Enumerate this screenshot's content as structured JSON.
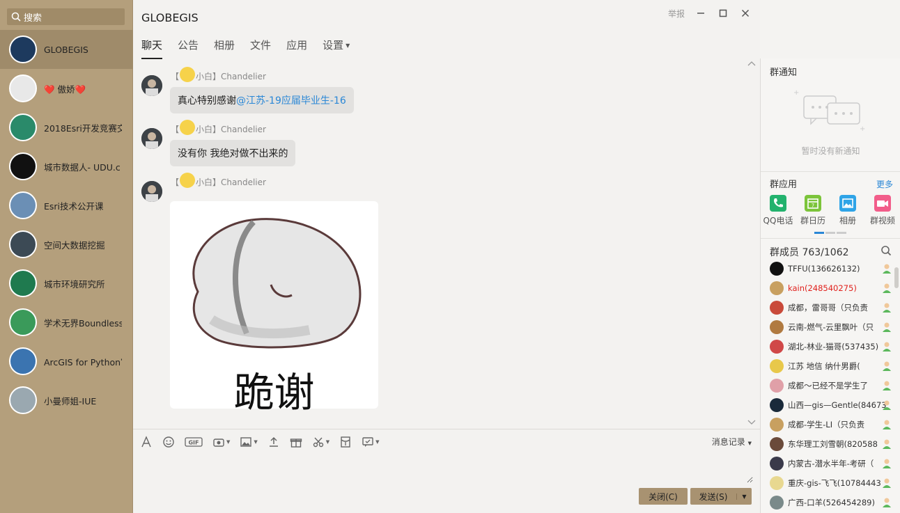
{
  "sidebar": {
    "search_label": "搜索",
    "conversations": [
      {
        "name": "GLOBEGIS",
        "avatar_color": "#1d3a5e"
      },
      {
        "name": "❤️ 傲娇❤️",
        "avatar_color": "#e8e8e8"
      },
      {
        "name": "2018Esri开发竞赛交",
        "avatar_color": "#2a8a6a"
      },
      {
        "name": "城市数据人- UDU.c",
        "avatar_color": "#111111"
      },
      {
        "name": "Esri技术公开课",
        "avatar_color": "#6b8fb5"
      },
      {
        "name": "空间大数据挖掘",
        "avatar_color": "#3c4a55"
      },
      {
        "name": "城市环境研究所",
        "avatar_color": "#1f7a4f"
      },
      {
        "name": "学术无界Boundless",
        "avatar_color": "#3a9a5a"
      },
      {
        "name": "ArcGIS for Python官",
        "avatar_color": "#3b74b0"
      },
      {
        "name": "小曼师姐-IUE",
        "avatar_color": "#9aa8b0"
      }
    ]
  },
  "header": {
    "title": "GLOBEGIS",
    "report_label": "举报",
    "tabs": [
      "聊天",
      "公告",
      "相册",
      "文件",
      "应用",
      "设置"
    ]
  },
  "messages": [
    {
      "sender_prefix": "【",
      "sender_tag": "小白",
      "sender_suffix": "】Chandelier",
      "text": "真心特别感谢",
      "mention": "@江苏-19应届毕业生-16"
    },
    {
      "sender_prefix": "【",
      "sender_tag": "小白",
      "sender_suffix": "】Chandelier",
      "text": "没有你  我绝对做不出来的"
    },
    {
      "sender_prefix": "【",
      "sender_tag": "小白",
      "sender_suffix": "】Chandelier",
      "sticker_caption": "跪谢"
    }
  ],
  "toolbar": {
    "history_label": "消息记录"
  },
  "input": {
    "value": ""
  },
  "actions": {
    "close_label": "关闭(C)",
    "send_label": "发送(S)"
  },
  "right_panel": {
    "notice_title": "群通知",
    "notice_empty": "暂时没有新通知",
    "apps_title": "群应用",
    "apps_more": "更多",
    "apps": [
      {
        "label": "QQ电话",
        "color": "#23b26d"
      },
      {
        "label": "群日历",
        "color": "#7cc43a"
      },
      {
        "label": "相册",
        "color": "#2fa4e7"
      },
      {
        "label": "群视频",
        "color": "#f25d8a"
      }
    ],
    "members_title": "群成员 763/1062",
    "members": [
      {
        "name": "TFFU(136626132)",
        "color": "#111111",
        "red": false
      },
      {
        "name": "kain(248540275)",
        "color": "#c8a060",
        "red": true
      },
      {
        "name": "成都，雷哥哥（只负责",
        "color": "#c94a3a",
        "red": false
      },
      {
        "name": "云南-燃气-云里飘叶（只",
        "color": "#b07a40",
        "red": false
      },
      {
        "name": "湖北-林业-猫哥(537435)",
        "color": "#d04848",
        "red": false
      },
      {
        "name": "江苏  地信   纳什男爵(",
        "color": "#e8c84a",
        "red": false
      },
      {
        "name": "成都～已经不是学生了",
        "color": "#e0a0a8",
        "red": false
      },
      {
        "name": "山西—gis—Gentle(84673",
        "color": "#1a2a3a",
        "red": false
      },
      {
        "name": "成都-学生-LI（只负责",
        "color": "#c8a060",
        "red": false
      },
      {
        "name": "东华理工刘雪朝(820588",
        "color": "#6a4a3a",
        "red": false
      },
      {
        "name": "内蒙古-潜水半年-考研（",
        "color": "#3a3a4a",
        "red": false
      },
      {
        "name": "重庆-gis-飞飞(10784443",
        "color": "#e8d890",
        "red": false
      },
      {
        "name": "广西-口羊(526454289)",
        "color": "#7a8a8a",
        "red": false
      }
    ]
  }
}
